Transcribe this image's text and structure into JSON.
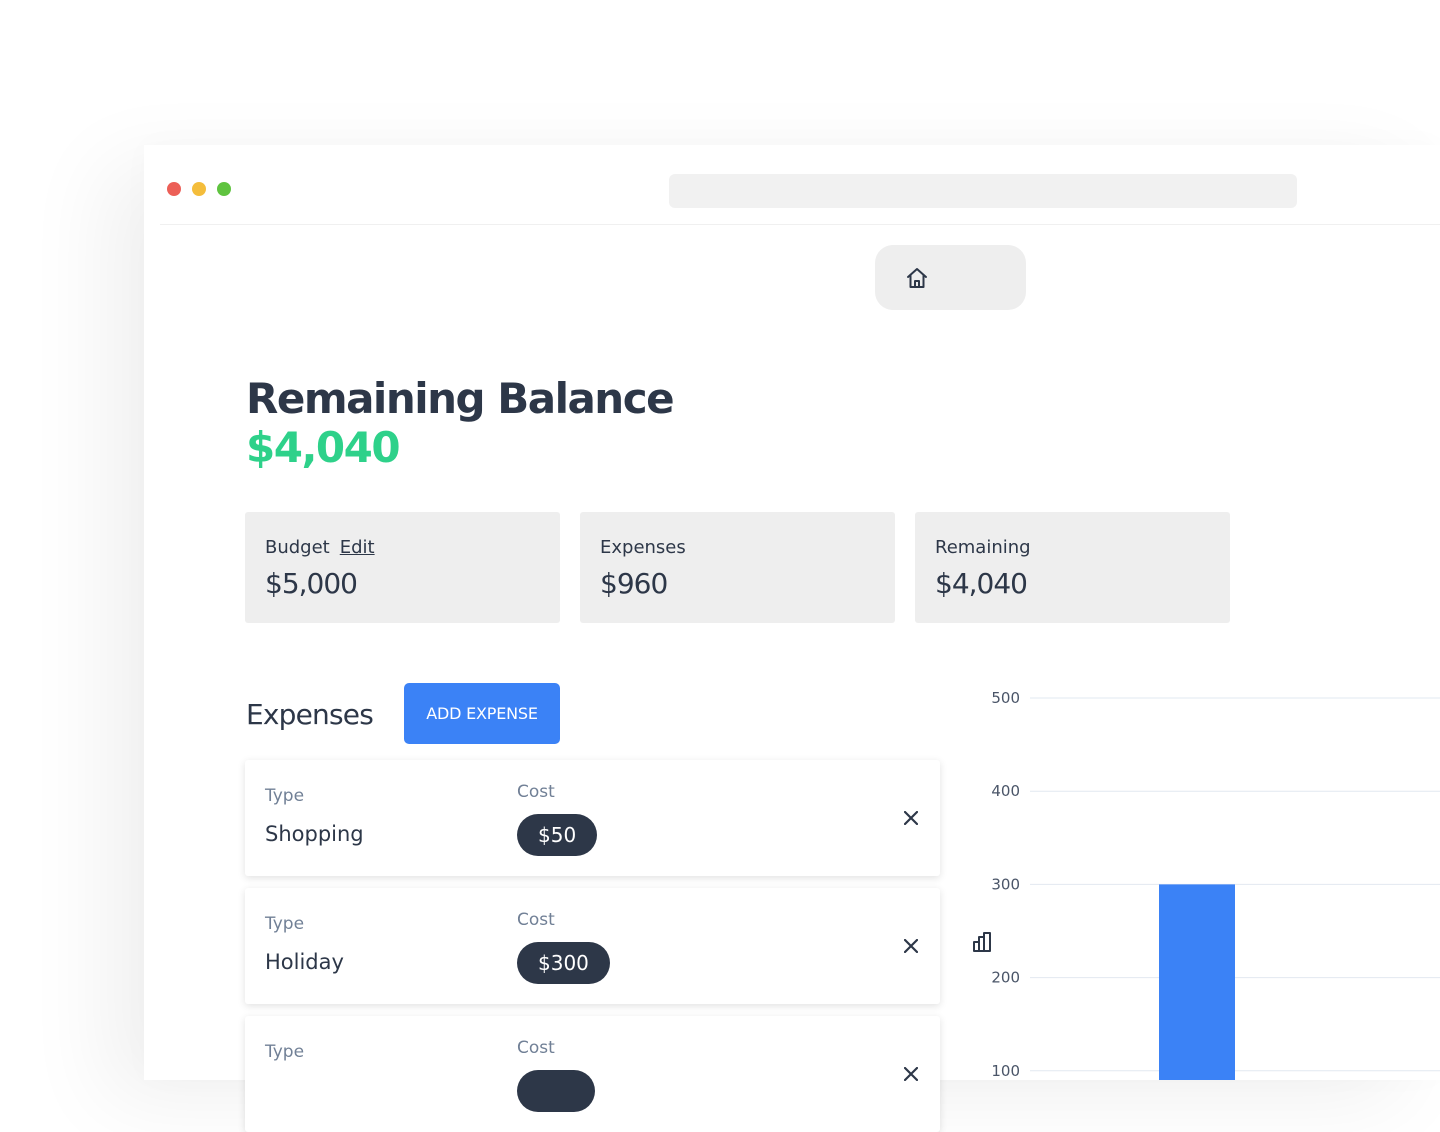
{
  "nav": {
    "home_icon": "home-icon",
    "chart_icon": "bar-chart-icon"
  },
  "header": {
    "title": "Remaining Balance",
    "balance": "$4,040",
    "balance_color": "#2ed18a"
  },
  "summary": {
    "budget": {
      "label": "Budget",
      "edit_label": "Edit",
      "value": "$5,000"
    },
    "expenses": {
      "label": "Expenses",
      "value": "$960"
    },
    "remaining": {
      "label": "Remaining",
      "value": "$4,040"
    }
  },
  "expenses_section": {
    "title": "Expenses",
    "add_button": "ADD EXPENSE",
    "items": [
      {
        "type_label": "Type",
        "type": "Shopping",
        "cost_label": "Cost",
        "cost": "$50"
      },
      {
        "type_label": "Type",
        "type": "Holiday",
        "cost_label": "Cost",
        "cost": "$300"
      },
      {
        "type_label": "Type",
        "type": "",
        "cost_label": "Cost",
        "cost": ""
      }
    ]
  },
  "chart_data": {
    "type": "bar",
    "y_ticks": [
      500,
      400,
      300,
      200,
      100
    ],
    "ylim": [
      0,
      500
    ],
    "values": [
      300
    ],
    "bar_color": "#3b82f6",
    "grid": true
  }
}
